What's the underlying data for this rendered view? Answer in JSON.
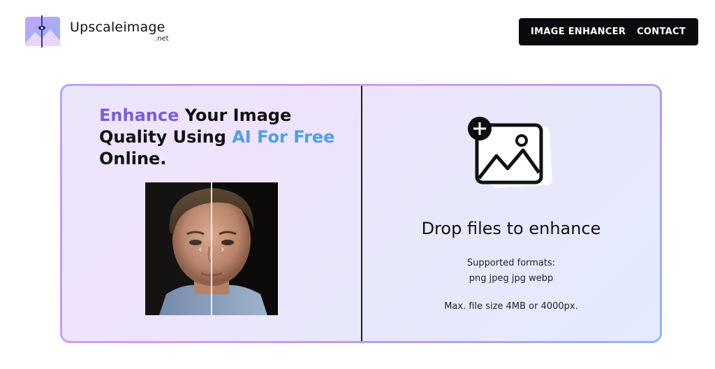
{
  "header": {
    "brand_name": "Upscaleimage",
    "brand_tld": ".net",
    "nav": [
      {
        "label": "IMAGE ENHANCER"
      },
      {
        "label": "CONTACT"
      }
    ]
  },
  "hero": {
    "headline": {
      "part1": "Enhance",
      "part2": " Your Image Quality Using ",
      "part3": "AI For Free",
      "part4": " Online."
    },
    "compare": {
      "left_arrow": "‹",
      "right_arrow": "›"
    }
  },
  "dropzone": {
    "title": "Drop files to enhance",
    "formats_label": "Supported formats:",
    "formats": "png jpeg jpg webp",
    "max_size": "Max. file size 4MB or 4000px."
  },
  "colors": {
    "accent_purple": "#7e5bd9",
    "accent_blue": "#4f9fea",
    "nav_bg": "#0b0b0f"
  },
  "icons": [
    "logo-icon",
    "add-image-icon",
    "chevron-left-icon",
    "chevron-right-icon"
  ]
}
